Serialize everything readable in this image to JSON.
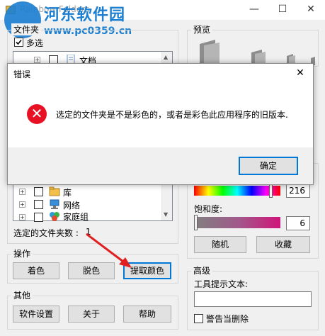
{
  "window": {
    "title": "Rainbow Folders",
    "minimize": "—",
    "maximize": "☐",
    "close": "✕"
  },
  "watermark": {
    "title": "河东软件园",
    "url": "www.pc0359.cn"
  },
  "folders": {
    "group_title": "文件夹",
    "multiselect_label": "多选",
    "multiselect_checked": true,
    "tree_items_top": [
      {
        "label": "文档",
        "icon": "document-folder-icon"
      }
    ],
    "tree_items_bottom": [
      {
        "label": "库",
        "icon": "library-folder-icon"
      },
      {
        "label": "网络",
        "icon": "network-icon"
      },
      {
        "label": "家庭组",
        "icon": "homegroup-icon"
      }
    ],
    "selected_count_label": "选定的文件夹数 :",
    "selected_count": "1"
  },
  "actions": {
    "group_title": "操作",
    "colorize_label": "着色",
    "decolorize_label": "脱色",
    "extract_label": "提取颜色"
  },
  "other": {
    "group_title": "其他",
    "settings_label": "软件设置",
    "about_label": "关于",
    "help_label": "帮助"
  },
  "preview": {
    "group_title": "预览"
  },
  "color": {
    "hue_value": "216",
    "saturation_label": "饱和度:",
    "saturation_value": "6",
    "random_label": "随机",
    "favorites_label": "收藏",
    "colors": {
      "accent": "#0078d7",
      "error": "#e81123"
    }
  },
  "advanced": {
    "group_title": "高级",
    "tooltip_label": "工具提示文本:",
    "tooltip_value": "",
    "warn_delete_label": "警告当删除",
    "warn_delete_checked": false
  },
  "dialog": {
    "title": "错误",
    "close": "✕",
    "message": "选定的文件夹是不是彩色的，或者是彩色此应用程序的旧版本.",
    "ok_label": "确定"
  }
}
